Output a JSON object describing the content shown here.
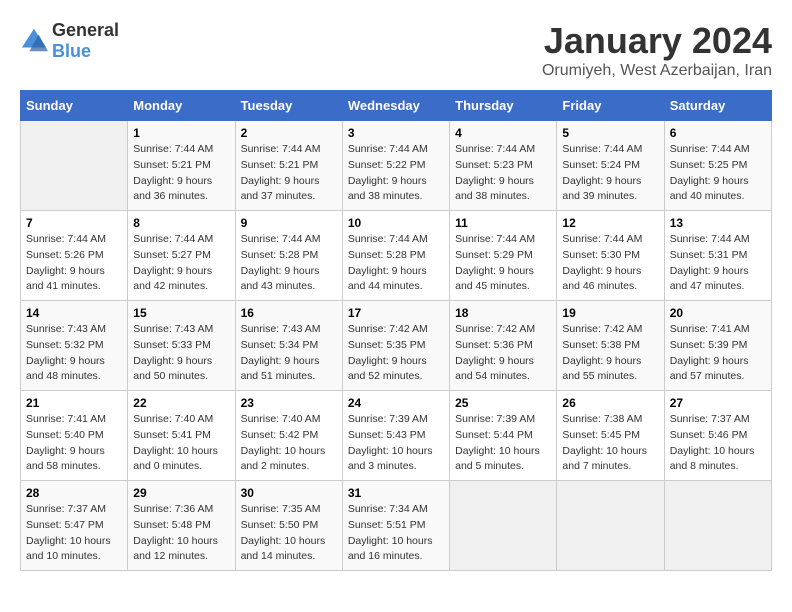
{
  "header": {
    "logo": {
      "general": "General",
      "blue": "Blue"
    },
    "title": "January 2024",
    "location": "Orumiyeh, West Azerbaijan, Iran"
  },
  "days_of_week": [
    "Sunday",
    "Monday",
    "Tuesday",
    "Wednesday",
    "Thursday",
    "Friday",
    "Saturday"
  ],
  "weeks": [
    [
      {
        "day": "",
        "empty": true
      },
      {
        "day": "1",
        "sunrise": "7:44 AM",
        "sunset": "5:21 PM",
        "daylight": "9 hours and 36 minutes."
      },
      {
        "day": "2",
        "sunrise": "7:44 AM",
        "sunset": "5:21 PM",
        "daylight": "9 hours and 37 minutes."
      },
      {
        "day": "3",
        "sunrise": "7:44 AM",
        "sunset": "5:22 PM",
        "daylight": "9 hours and 38 minutes."
      },
      {
        "day": "4",
        "sunrise": "7:44 AM",
        "sunset": "5:23 PM",
        "daylight": "9 hours and 38 minutes."
      },
      {
        "day": "5",
        "sunrise": "7:44 AM",
        "sunset": "5:24 PM",
        "daylight": "9 hours and 39 minutes."
      },
      {
        "day": "6",
        "sunrise": "7:44 AM",
        "sunset": "5:25 PM",
        "daylight": "9 hours and 40 minutes."
      }
    ],
    [
      {
        "day": "7",
        "sunrise": "7:44 AM",
        "sunset": "5:26 PM",
        "daylight": "9 hours and 41 minutes."
      },
      {
        "day": "8",
        "sunrise": "7:44 AM",
        "sunset": "5:27 PM",
        "daylight": "9 hours and 42 minutes."
      },
      {
        "day": "9",
        "sunrise": "7:44 AM",
        "sunset": "5:28 PM",
        "daylight": "9 hours and 43 minutes."
      },
      {
        "day": "10",
        "sunrise": "7:44 AM",
        "sunset": "5:28 PM",
        "daylight": "9 hours and 44 minutes."
      },
      {
        "day": "11",
        "sunrise": "7:44 AM",
        "sunset": "5:29 PM",
        "daylight": "9 hours and 45 minutes."
      },
      {
        "day": "12",
        "sunrise": "7:44 AM",
        "sunset": "5:30 PM",
        "daylight": "9 hours and 46 minutes."
      },
      {
        "day": "13",
        "sunrise": "7:44 AM",
        "sunset": "5:31 PM",
        "daylight": "9 hours and 47 minutes."
      }
    ],
    [
      {
        "day": "14",
        "sunrise": "7:43 AM",
        "sunset": "5:32 PM",
        "daylight": "9 hours and 48 minutes."
      },
      {
        "day": "15",
        "sunrise": "7:43 AM",
        "sunset": "5:33 PM",
        "daylight": "9 hours and 50 minutes."
      },
      {
        "day": "16",
        "sunrise": "7:43 AM",
        "sunset": "5:34 PM",
        "daylight": "9 hours and 51 minutes."
      },
      {
        "day": "17",
        "sunrise": "7:42 AM",
        "sunset": "5:35 PM",
        "daylight": "9 hours and 52 minutes."
      },
      {
        "day": "18",
        "sunrise": "7:42 AM",
        "sunset": "5:36 PM",
        "daylight": "9 hours and 54 minutes."
      },
      {
        "day": "19",
        "sunrise": "7:42 AM",
        "sunset": "5:38 PM",
        "daylight": "9 hours and 55 minutes."
      },
      {
        "day": "20",
        "sunrise": "7:41 AM",
        "sunset": "5:39 PM",
        "daylight": "9 hours and 57 minutes."
      }
    ],
    [
      {
        "day": "21",
        "sunrise": "7:41 AM",
        "sunset": "5:40 PM",
        "daylight": "9 hours and 58 minutes."
      },
      {
        "day": "22",
        "sunrise": "7:40 AM",
        "sunset": "5:41 PM",
        "daylight": "10 hours and 0 minutes."
      },
      {
        "day": "23",
        "sunrise": "7:40 AM",
        "sunset": "5:42 PM",
        "daylight": "10 hours and 2 minutes."
      },
      {
        "day": "24",
        "sunrise": "7:39 AM",
        "sunset": "5:43 PM",
        "daylight": "10 hours and 3 minutes."
      },
      {
        "day": "25",
        "sunrise": "7:39 AM",
        "sunset": "5:44 PM",
        "daylight": "10 hours and 5 minutes."
      },
      {
        "day": "26",
        "sunrise": "7:38 AM",
        "sunset": "5:45 PM",
        "daylight": "10 hours and 7 minutes."
      },
      {
        "day": "27",
        "sunrise": "7:37 AM",
        "sunset": "5:46 PM",
        "daylight": "10 hours and 8 minutes."
      }
    ],
    [
      {
        "day": "28",
        "sunrise": "7:37 AM",
        "sunset": "5:47 PM",
        "daylight": "10 hours and 10 minutes."
      },
      {
        "day": "29",
        "sunrise": "7:36 AM",
        "sunset": "5:48 PM",
        "daylight": "10 hours and 12 minutes."
      },
      {
        "day": "30",
        "sunrise": "7:35 AM",
        "sunset": "5:50 PM",
        "daylight": "10 hours and 14 minutes."
      },
      {
        "day": "31",
        "sunrise": "7:34 AM",
        "sunset": "5:51 PM",
        "daylight": "10 hours and 16 minutes."
      },
      {
        "day": "",
        "empty": true
      },
      {
        "day": "",
        "empty": true
      },
      {
        "day": "",
        "empty": true
      }
    ]
  ]
}
